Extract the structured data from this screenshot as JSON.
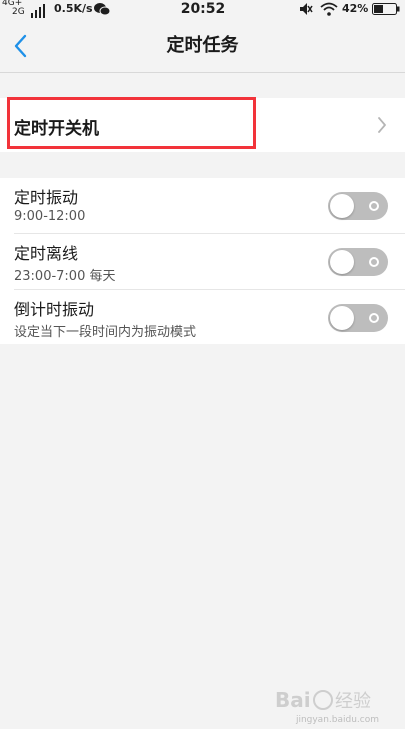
{
  "status_bar": {
    "net_top": "4G+",
    "net_bottom": "2G",
    "speed": "0.5K/s",
    "time": "20:52",
    "battery": "42%",
    "icons": [
      "signal-icon",
      "wechat-icon",
      "mute-icon",
      "wifi-icon",
      "battery-icon"
    ]
  },
  "title_bar": {
    "back_icon": "chevron-left-icon",
    "title": "定时任务",
    "accent_color": "#1e90e8"
  },
  "items": [
    {
      "title": "定时开关机",
      "chevron_icon": "chevron-right-icon",
      "highlighted": true,
      "highlight_color": "#f2333a"
    },
    {
      "title": "定时振动",
      "subtitle": "9:00-12:00",
      "toggle_on": false
    },
    {
      "title": "定时离线",
      "subtitle": "23:00-7:00 每天",
      "toggle_on": false
    },
    {
      "title": "倒计时振动",
      "subtitle": "设定当下一段时间内为振动模式",
      "toggle_on": false
    }
  ],
  "watermark": {
    "logo": "Baidu经验",
    "url": "jingyan.baidu.com"
  }
}
